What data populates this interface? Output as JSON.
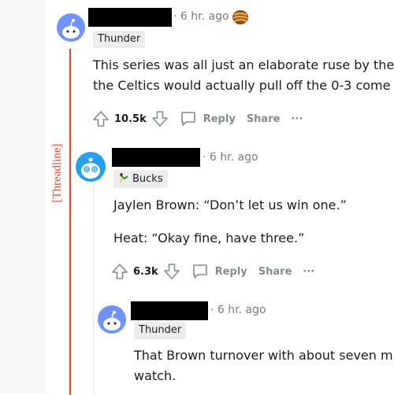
{
  "annotation": {
    "label": "[Threadline]"
  },
  "comments": [
    {
      "time": "· 6 hr. ago",
      "flair": "Thunder",
      "body": [
        "This series was all just an elaborate ruse by the",
        "the Celtics would actually pull off the 0-3 come"
      ],
      "score": "10.5k",
      "reply_label": "Reply",
      "share_label": "Share",
      "more_label": "···"
    },
    {
      "time": "· 6 hr. ago",
      "flair": "Bucks",
      "body": [
        "Jaylen Brown: “Don’t let us win one.”",
        "Heat: “Okay fine, have three.”"
      ],
      "score": "6.3k",
      "reply_label": "Reply",
      "share_label": "Share",
      "more_label": "···"
    },
    {
      "time": "· 6 hr. ago",
      "flair": "Thunder",
      "body": [
        "That Brown turnover with about seven m",
        "watch."
      ]
    }
  ],
  "colors": {
    "annotation_red": "#e8412c",
    "avatar_blue": "#7193ff",
    "action_gray": "#878a8c"
  }
}
